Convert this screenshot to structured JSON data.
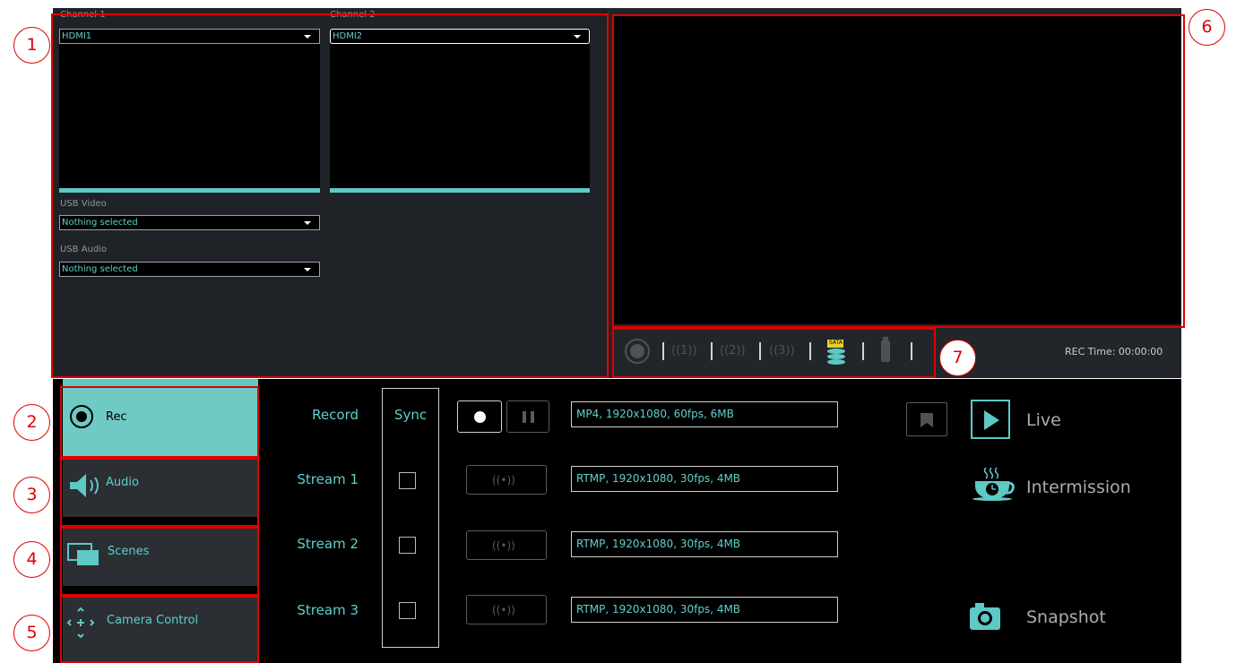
{
  "sources": {
    "channel1": {
      "label": "Channel 1",
      "value": "HDMI1"
    },
    "channel2": {
      "label": "Channel 2",
      "value": "HDMI2"
    },
    "usb_video": {
      "label": "USB Video",
      "value": "Nothing selected"
    },
    "usb_audio": {
      "label": "USB Audio",
      "value": "Nothing selected"
    }
  },
  "status": {
    "rec_time": "REC Time: 00:00:00",
    "stream_icons": [
      "((1))",
      "((2))",
      "((3))"
    ],
    "sata_label": "SATA"
  },
  "sidebar": {
    "items": [
      {
        "label": "Rec",
        "icon": "record-icon",
        "active": true
      },
      {
        "label": "Audio",
        "icon": "speaker-icon"
      },
      {
        "label": "Scenes",
        "icon": "scenes-icon"
      },
      {
        "label": "Camera Control",
        "icon": "camera-control-icon"
      }
    ]
  },
  "rec_panel": {
    "sync_label": "Sync",
    "rows": [
      {
        "label": "Record",
        "config": "MP4, 1920x1080, 60fps, 6MB"
      },
      {
        "label": "Stream 1",
        "config": "RTMP, 1920x1080, 30fps, 4MB"
      },
      {
        "label": "Stream 2",
        "config": "RTMP, 1920x1080, 30fps, 4MB"
      },
      {
        "label": "Stream 3",
        "config": "RTMP, 1920x1080, 30fps, 4MB"
      }
    ],
    "stream_btn_glyph": "((•))"
  },
  "actions": {
    "live": "Live",
    "intermission": "Intermission",
    "snapshot": "Snapshot"
  },
  "callouts": [
    "1",
    "2",
    "3",
    "4",
    "5",
    "6",
    "7"
  ],
  "colors": {
    "accent": "#5ec9c5",
    "annotation": "#e00000",
    "panel": "#1f2226"
  }
}
